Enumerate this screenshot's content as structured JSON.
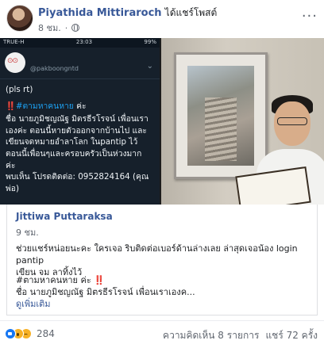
{
  "post": {
    "author": "Piyathida Mittiraroch",
    "action": "ได้แชร์โพสต์",
    "time": "8 ชม.",
    "more": "···"
  },
  "phone": {
    "status": {
      "carrier": "TRUE-H",
      "time": "23:03",
      "battery": "99%"
    },
    "handle": "@pakboongntd",
    "pls": "(pls rt)",
    "excl": "‼️",
    "hashtag": "#ตามหาคนหาย",
    "tag_suffix": " ค่ะ",
    "body": "ชื่อ นายภูมิชญณัฐ มิตรธีรโรจน์ เพื่อนเรา\nเองค่ะ ตอนนี้หายตัวออกจากบ้านไป และ\nเขียนจดหมายอำลาโลก ในpantip ไว้\nตอนนี้เพื่อนๆและครอบครัวเป็นห่วงมาก\nค่ะ\nพบเห็น โปรดติดต่อ: 0952824164 (คุณ\nพ่อ)"
  },
  "shared": {
    "name": "Jittiwa Puttaraksa",
    "time": "9 ชม.",
    "text": "ช่วยแชร์หน่อยนะคะ ใครเจอ ริบติดต่อเบอร์ด้านล่างเลย ล่าสุดเจอน้อง login pantip\nเขียน จม ลาทิ้งไว้",
    "tag_line": "#ตามหาคนหาย ค่ะ",
    "excl": "‼️",
    "line2": "ชื่อ นายภูมิชญณัฐ มิตรธีรโรจน์ เพื่อนเราเองค...",
    "see_more": "ดูเพิ่มเติม"
  },
  "footer": {
    "reaction_count": "284",
    "comments": "ความคิดเห็น 8 รายการ",
    "shares": "แชร์ 72 ครั้ง"
  }
}
